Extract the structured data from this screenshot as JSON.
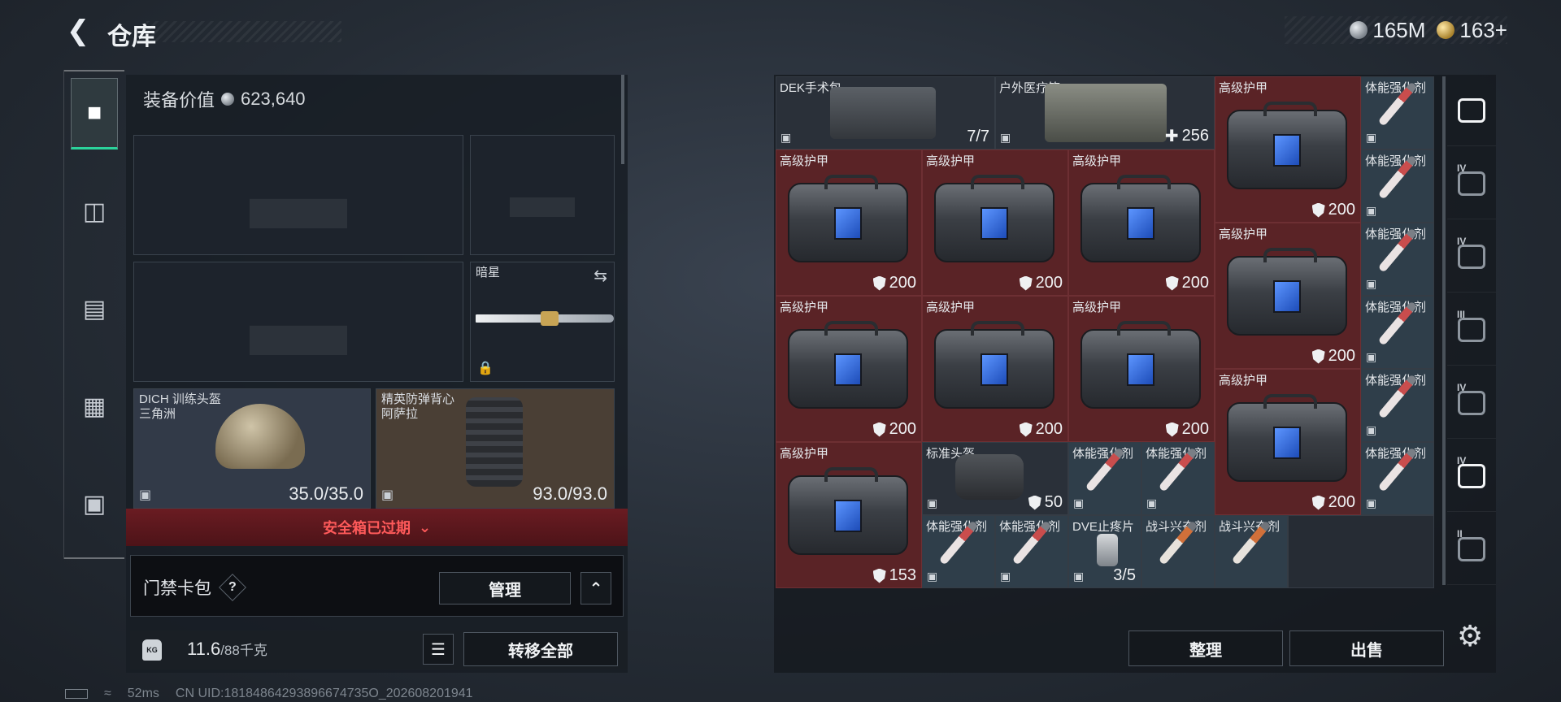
{
  "header": {
    "title": "仓库",
    "currency": [
      {
        "icon": "silver-coin-icon",
        "value": "165M"
      },
      {
        "icon": "gold-coin-icon",
        "value": "163+"
      }
    ]
  },
  "left_tabs": [
    {
      "icon": "pistol-icon",
      "active": true
    },
    {
      "icon": "vest-icon",
      "active": false
    },
    {
      "icon": "backpack-icon",
      "active": false
    },
    {
      "icon": "rig-icon",
      "active": false
    },
    {
      "icon": "briefcase-icon",
      "active": false
    }
  ],
  "equipment": {
    "value_label": "装备价值",
    "value": "623,640",
    "knife": {
      "name": "暗星"
    },
    "helmet": {
      "name": "DICH 训练头盔",
      "sub": "三角洲",
      "durability": "35.0/35.0"
    },
    "vest": {
      "name": "精英防弹背心",
      "sub": "阿萨拉",
      "durability": "93.0/93.0"
    },
    "safe_box_status": "安全箱已过期",
    "key_wallet": {
      "label": "门禁卡包",
      "help": "?",
      "manage": "管理"
    },
    "weight": {
      "current": "11.6",
      "max": "/88千克",
      "unit_icon": "KG"
    },
    "transfer_all": "转移全部"
  },
  "inventory": {
    "items": [
      {
        "name": "DEK手术包",
        "value": "7/7"
      },
      {
        "name": "户外医疗箱",
        "value": "256"
      },
      {
        "name": "高级护甲",
        "value": "200"
      },
      {
        "name": "体能强化剂",
        "value": ""
      },
      {
        "name": "高级护甲",
        "value": "200"
      },
      {
        "name": "高级护甲",
        "value": "200"
      },
      {
        "name": "高级护甲",
        "value": "200"
      },
      {
        "name": "体能强化剂",
        "value": ""
      },
      {
        "name": "高级护甲",
        "value": "200"
      },
      {
        "name": "体能强化剂",
        "value": ""
      },
      {
        "name": "高级护甲",
        "value": "200"
      },
      {
        "name": "高级护甲",
        "value": "200"
      },
      {
        "name": "高级护甲",
        "value": "200"
      },
      {
        "name": "体能强化剂",
        "value": ""
      },
      {
        "name": "高级护甲",
        "value": "200"
      },
      {
        "name": "体能强化剂",
        "value": ""
      },
      {
        "name": "高级护甲",
        "value": "153"
      },
      {
        "name": "标准头盔",
        "value": "50"
      },
      {
        "name": "体能强化剂",
        "value": ""
      },
      {
        "name": "体能强化剂",
        "value": ""
      },
      {
        "name": "体能强化剂",
        "value": ""
      },
      {
        "name": "体能强化剂",
        "value": ""
      },
      {
        "name": "体能强化剂",
        "value": ""
      },
      {
        "name": "DVE止疼片",
        "value": "3/5"
      },
      {
        "name": "战斗兴奋剂",
        "value": ""
      },
      {
        "name": "战斗兴奋剂",
        "value": ""
      }
    ],
    "sort_label": "整理",
    "sell_label": "出售"
  },
  "right_tabs": [
    {
      "icon": "storage-icon",
      "roman": ""
    },
    {
      "icon": "container-icon",
      "roman": "IV"
    },
    {
      "icon": "container-icon",
      "roman": "IV"
    },
    {
      "icon": "container-icon",
      "roman": "III"
    },
    {
      "icon": "container-icon",
      "roman": "IV"
    },
    {
      "icon": "add-container-icon",
      "roman": "IV"
    },
    {
      "icon": "add-container-icon",
      "roman": "II"
    }
  ],
  "footer": {
    "ping": "52ms",
    "uid": "CN UID:18184864293896674735O_202608201941"
  }
}
